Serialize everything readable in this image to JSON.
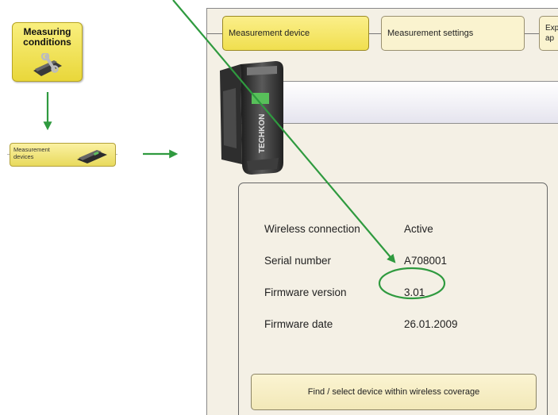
{
  "left_panel": {
    "measuring_conditions": "Measuring conditions",
    "measurement_devices": "Measurement devices"
  },
  "app": {
    "steps": [
      "Measurement device",
      "Measurement settings",
      "Exp ap"
    ],
    "device_brand": "TECHKON",
    "info": {
      "rows": [
        {
          "label": "Wireless connection",
          "value": "Active"
        },
        {
          "label": "Serial number",
          "value": "A708001"
        },
        {
          "label": "Firmware version",
          "value": "3.01"
        },
        {
          "label": "Firmware date",
          "value": "26.01.2009"
        }
      ],
      "find_button": "Find / select device within wireless coverage"
    }
  },
  "colors": {
    "arrow": "#2f9a3f",
    "accent_yellow": "#f2e04e"
  }
}
